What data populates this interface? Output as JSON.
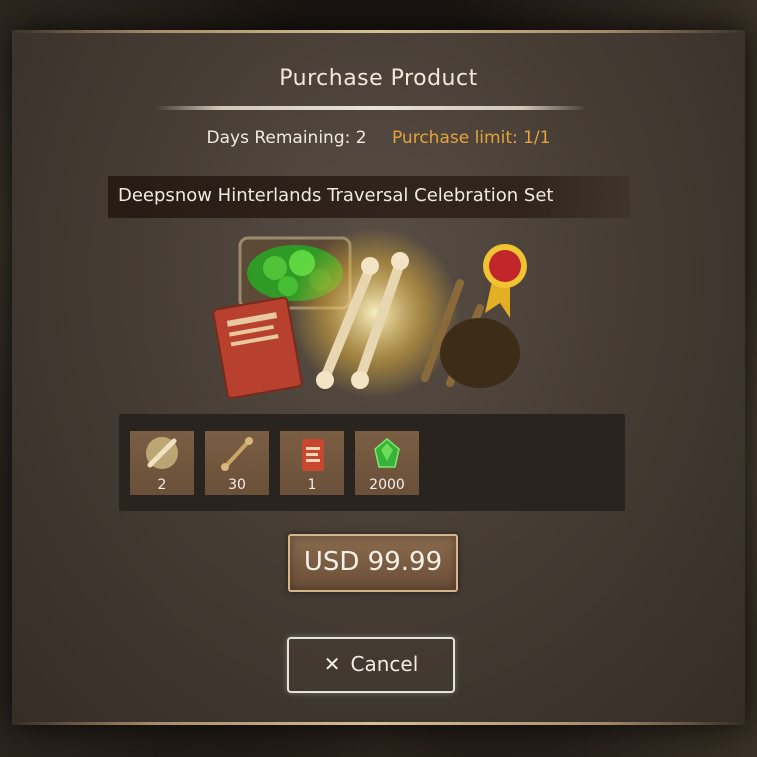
{
  "dialog": {
    "title": "Purchase Product",
    "days_remaining": "Days Remaining: 2",
    "purchase_limit": "Purchase limit: 1/1",
    "set_name": "Deepsnow Hinterlands Traversal Celebration Set"
  },
  "items": [
    {
      "icon": "glowing-bone-icon",
      "qty": "2"
    },
    {
      "icon": "bone-icon",
      "qty": "30"
    },
    {
      "icon": "scroll-icon",
      "qty": "1"
    },
    {
      "icon": "green-gem-icon",
      "qty": "2000"
    }
  ],
  "buttons": {
    "price_label": "USD 99.99",
    "cancel_label": "Cancel",
    "cancel_icon": "close-icon"
  },
  "colors": {
    "limit_accent": "#e5a33d",
    "panel": "#463d35"
  }
}
